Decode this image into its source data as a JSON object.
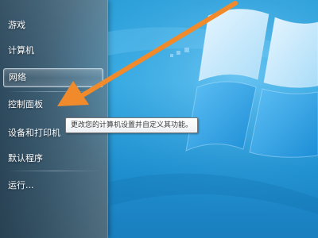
{
  "start_menu": {
    "items": [
      {
        "label": "游戏"
      },
      {
        "label": "计算机"
      },
      {
        "label": "网络"
      },
      {
        "label": "控制面板"
      },
      {
        "label": "设备和打印机"
      },
      {
        "label": "默认程序"
      },
      {
        "label": "运行..."
      }
    ]
  },
  "tooltip": {
    "text": "更改您的计算机设置并自定义其功能。"
  },
  "annotation": {
    "color": "#f08a2a"
  },
  "desktop": {
    "wallpaper_icon": "windows-logo-icon",
    "accent": "#2a9ed8"
  }
}
